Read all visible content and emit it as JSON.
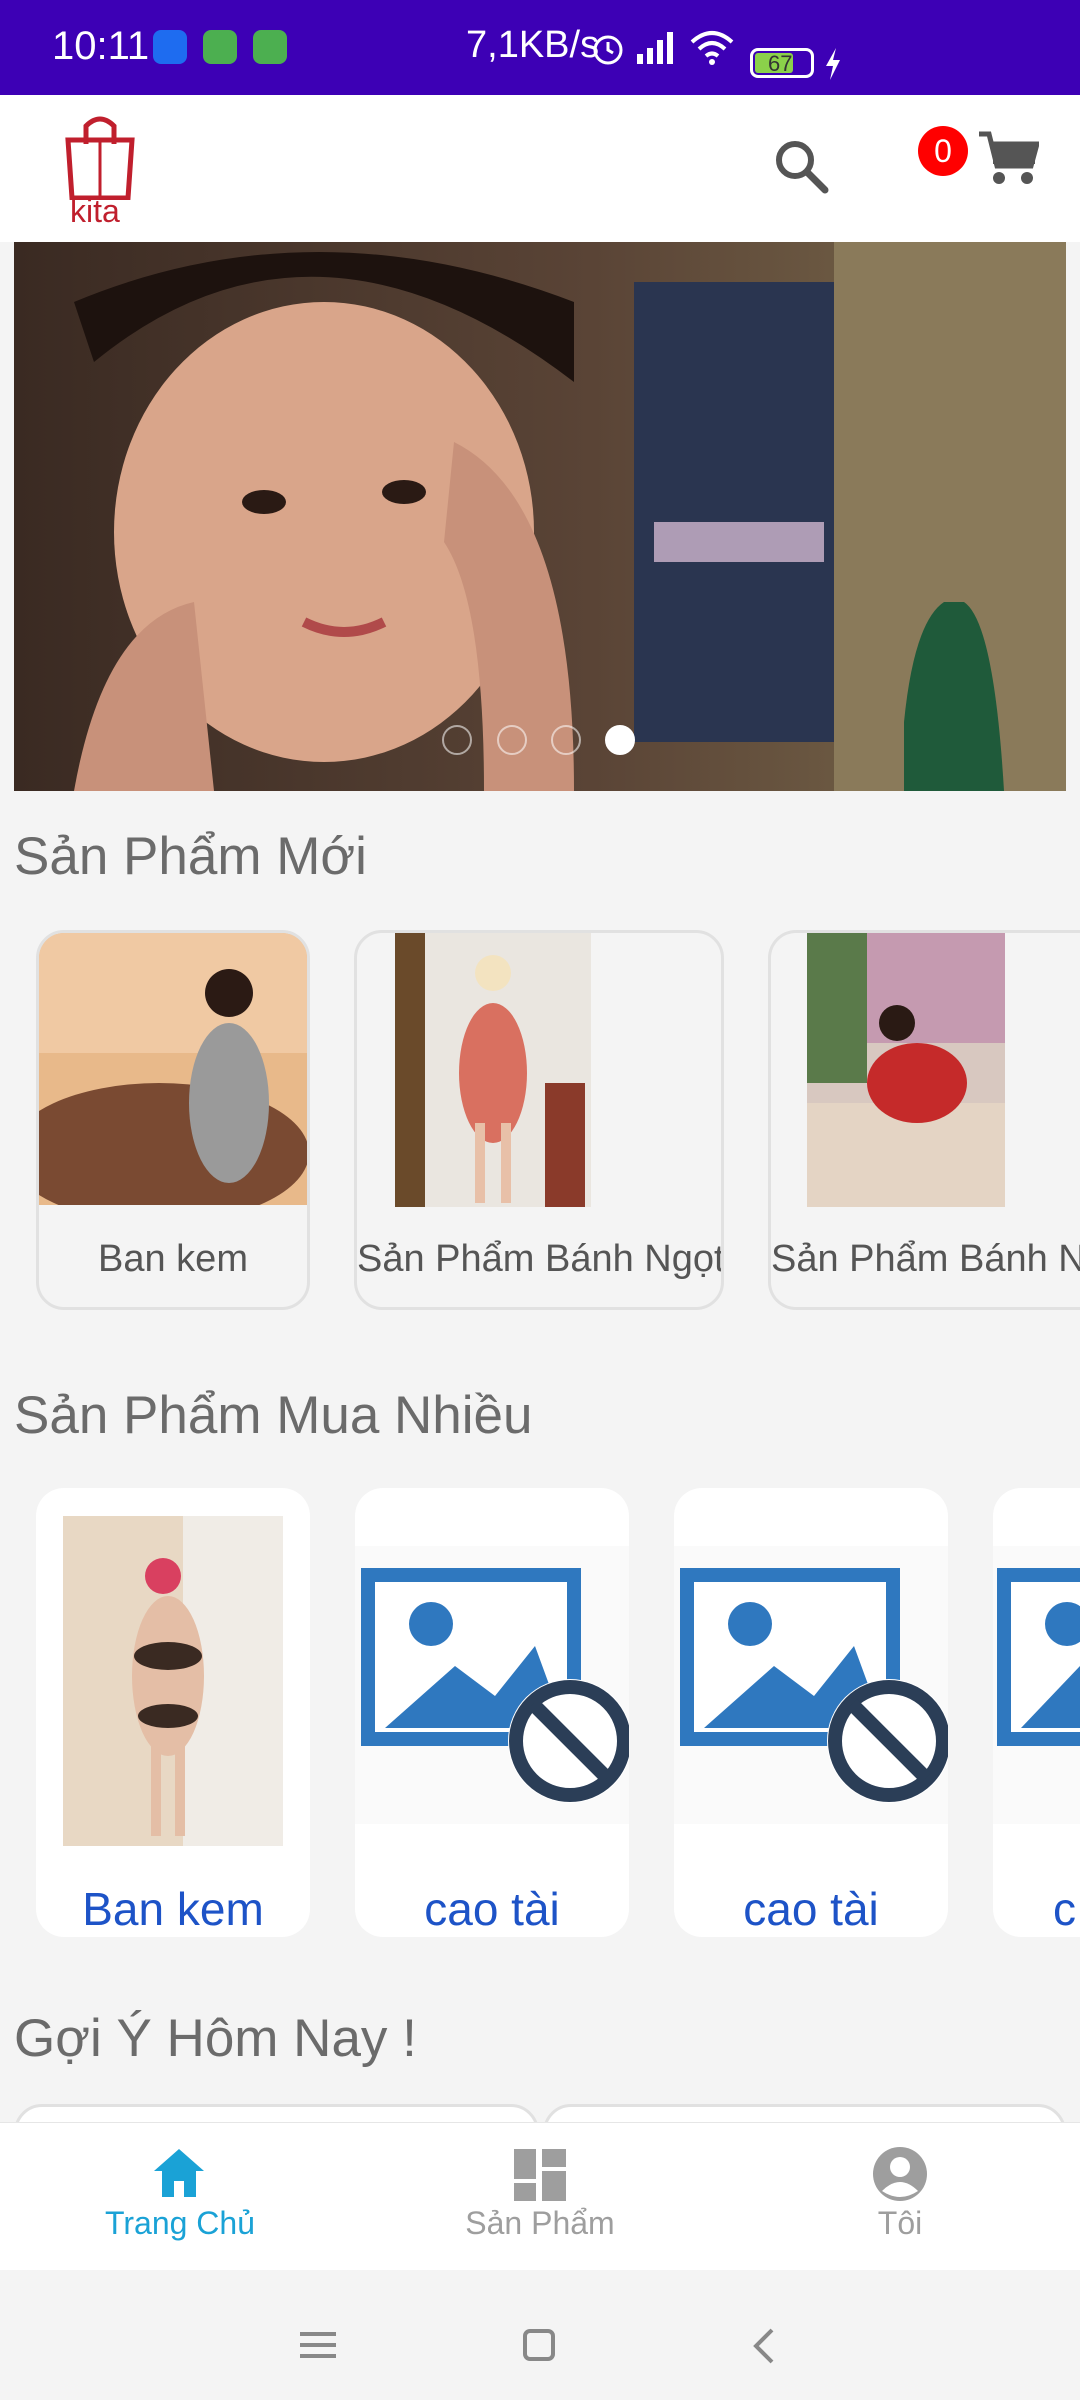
{
  "status_bar": {
    "time": "10:11",
    "network_speed": "7,1KB/s",
    "battery": "67",
    "notification_icons": [
      "zalo-icon",
      "app-icon",
      "android-icon"
    ],
    "color": "#3d00b5"
  },
  "header": {
    "logo_text": "kita",
    "cart_count": "0"
  },
  "banner": {
    "slide_count": 4,
    "active_slide": 4
  },
  "sections": {
    "new_products_title": "Sản Phẩm Mới",
    "top_products_title": "Sản Phẩm Mua Nhiều",
    "suggest_title": "Gợi Ý Hôm Nay !"
  },
  "new_products": [
    {
      "name": "Ban kem"
    },
    {
      "name": "Sản Phẩm Bánh Ngọt"
    },
    {
      "name": "Sản Phẩm Bánh N"
    }
  ],
  "top_products": [
    {
      "name": "Ban kem"
    },
    {
      "name": "cao tài"
    },
    {
      "name": "cao tài"
    },
    {
      "name": "c"
    }
  ],
  "bottom_nav": {
    "items": [
      {
        "label": "Trang Chủ",
        "icon": "home-icon",
        "active": true
      },
      {
        "label": "Sản Phẩm",
        "icon": "dashboard-icon",
        "active": false
      },
      {
        "label": "Tôi",
        "icon": "account-icon",
        "active": false
      }
    ],
    "active_color": "#1aa2d6",
    "inactive_color": "#9e9e9e"
  }
}
